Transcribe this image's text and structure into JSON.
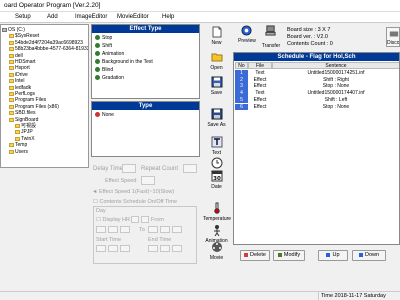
{
  "window": {
    "title": "oard Operator Program [Ver.2.20]"
  },
  "menu": [
    "Setup",
    "Add",
    "ImageEditor",
    "MovieEditor",
    "Help"
  ],
  "folders": [
    {
      "label": "OS (C:)",
      "kind": "drive"
    },
    {
      "label": "$SysReset",
      "kind": "folder"
    },
    {
      "label": "54bde2d4f7204a39ac6698923",
      "kind": "folder"
    },
    {
      "label": "58b23ba4bbbe-4577-6364-8193325",
      "kind": "folder"
    },
    {
      "label": "dell",
      "kind": "folder"
    },
    {
      "label": "HDSmart",
      "kind": "folder"
    },
    {
      "label": "Hsport",
      "kind": "folder"
    },
    {
      "label": "iDrive",
      "kind": "folder"
    },
    {
      "label": "Intel",
      "kind": "folder"
    },
    {
      "label": "ledfadk",
      "kind": "folder"
    },
    {
      "label": "PerfLogs",
      "kind": "folder"
    },
    {
      "label": "Program Files",
      "kind": "folder"
    },
    {
      "label": "Program Files (x86)",
      "kind": "folder"
    },
    {
      "label": "SBD.files",
      "kind": "folder"
    },
    {
      "label": "SignBoard",
      "kind": "folder"
    },
    {
      "label": "可視設",
      "kind": "folder"
    },
    {
      "label": "JPJP",
      "kind": "folder"
    },
    {
      "label": "TwinX",
      "kind": "folder"
    },
    {
      "label": "Temp",
      "kind": "folder"
    },
    {
      "label": "Users",
      "kind": "folder"
    }
  ],
  "effect_panel": {
    "title": "Effect Type",
    "items": [
      "Stop",
      "Shift",
      "Animation",
      "Background in the Text",
      "Blind",
      "Gradation"
    ]
  },
  "type_panel": {
    "title": "Type",
    "items": [
      "None"
    ]
  },
  "timing": {
    "delay_time": "Delay Time",
    "repeat_count": "Repeat Count",
    "effect_speed": "Effect Speed",
    "effect_speed_range": "◄ Effect Speed 1(Fast)~10(Slow)",
    "contents_schedule": "Contents Schedule On/Off Time",
    "day": "Day",
    "display_hr": "Display HR",
    "from": "From",
    "to": "To",
    "start_time": "Start Time",
    "end_time": "End Time"
  },
  "toolbar": [
    {
      "label": "New",
      "icon": "new-file-icon"
    },
    {
      "label": "Open",
      "icon": "open-folder-icon"
    },
    {
      "label": "Save",
      "icon": "save-icon"
    },
    {
      "label": "Save As",
      "icon": "save-as-icon"
    },
    {
      "label": "Text",
      "icon": "text-icon"
    },
    {
      "label": "Time",
      "icon": "clock-icon"
    },
    {
      "label": "Date",
      "icon": "calendar-icon"
    },
    {
      "label": "Temperature",
      "icon": "thermometer-icon"
    },
    {
      "label": "Animation",
      "icon": "animation-icon"
    },
    {
      "label": "Movie",
      "icon": "movie-icon"
    }
  ],
  "calendar_day": "30",
  "top_right": {
    "preview_label": "Preview",
    "transfer_label": "Transfer",
    "board_size": "Board size : 3 X 7",
    "board_ver": "Board ver. : V2.0",
    "contents_count": "Contents Count : 0",
    "disconnect_label": "Disco"
  },
  "schedule": {
    "title": "Schedule - Flag for Hol,Sch",
    "columns": [
      "No",
      "File",
      "Sentence"
    ],
    "rows": [
      {
        "no": "1",
        "file": "Text",
        "sentence": "Untitled150000174251.inf"
      },
      {
        "no": "2",
        "file": "Effect",
        "sentence": "Shift : Right"
      },
      {
        "no": "3",
        "file": "Effect",
        "sentence": "Stop : None"
      },
      {
        "no": "4",
        "file": "Text",
        "sentence": "Untitled150000174407.inf"
      },
      {
        "no": "5",
        "file": "Effect",
        "sentence": "Shift : Left"
      },
      {
        "no": "6",
        "file": "Effect",
        "sentence": "Stop : None"
      }
    ]
  },
  "bottom_buttons": {
    "delete": "Delete",
    "modify": "Modify",
    "up": "Up",
    "down": "Down"
  },
  "status": {
    "left": "",
    "time": "Time 2018-11-17 Saturday 21:44:25"
  }
}
